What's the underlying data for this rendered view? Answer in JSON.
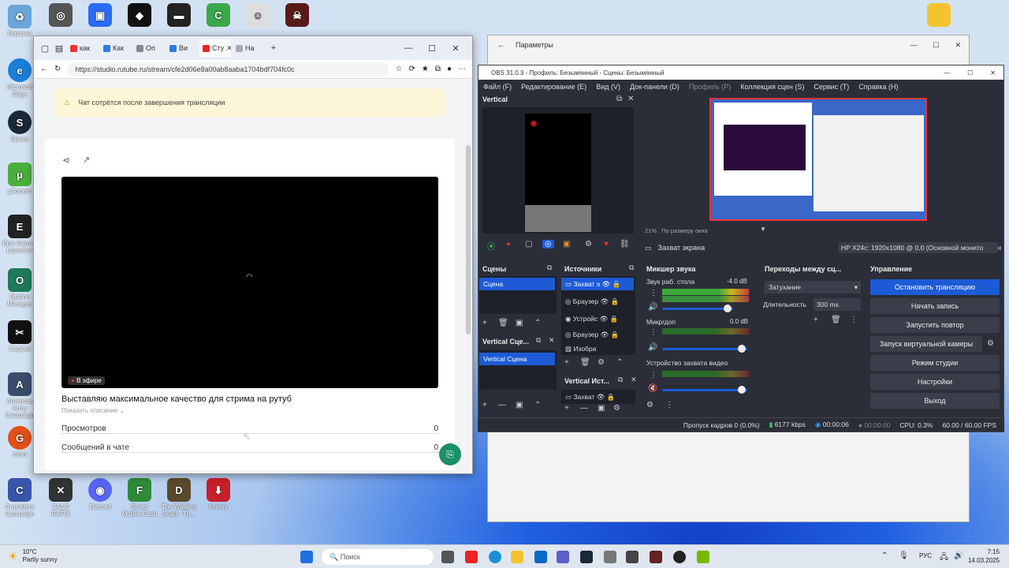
{
  "desktop": {
    "icons": [
      {
        "label": "Корзина",
        "color": "#6aa6d8"
      },
      {
        "label": "Microsoft Edge",
        "color": "#1a7fd8"
      },
      {
        "label": "Steam",
        "color": "#1b2838"
      },
      {
        "label": "µTorrent",
        "color": "#4caf3c"
      },
      {
        "label": "Epic Games Launcher",
        "color": "#222"
      },
      {
        "label": "Outline Manager",
        "color": "#1f7a5a"
      },
      {
        "label": "CapCut",
        "color": "#111"
      },
      {
        "label": "Americas Army Campaign",
        "color": "#3a4c6a"
      },
      {
        "label": "GOG",
        "color": "#e05018"
      },
      {
        "label": "Crusaders Campaign",
        "color": "#3855a8"
      }
    ],
    "top_icons": [
      "Outline",
      "Roblox Player",
      "Roblox Studio",
      "Garena",
      "CCleaner",
      "Rayman",
      "Rainbow"
    ],
    "bottom_icons": [
      "SALG RAFIX",
      "Discord",
      "Street Mobile Cash",
      "The Walking Dead - Th...",
      "Ummy"
    ]
  },
  "browser": {
    "tabs": [
      "как",
      "Как",
      "Оп",
      "Ви",
      "Сту",
      "На"
    ],
    "active_tab_index": 4,
    "url": "https://studio.rutube.ru/stream/cfe2d06e8a00ab8aaba1704bdf704fc0c",
    "notice": "Чат сотрётся после завершения трансляции",
    "live_badge": "В эфире",
    "stream_title": "Выставляю максимальное качество для стрима на рутуб",
    "show_description": "Показать описание",
    "stats": [
      {
        "label": "Просмотров",
        "value": "0"
      },
      {
        "label": "Сообщений в чате",
        "value": "0"
      }
    ]
  },
  "settings_window": {
    "title": "Параметры"
  },
  "obs": {
    "title": "OBS 31.0.3 - Профиль: Безымянный - Сцены: Безымянный",
    "menu": [
      "Файл (F)",
      "Редактирование (E)",
      "Вид (V)",
      "Док-панели (D)",
      "Профиль (P)",
      "Коллекция сцен (S)",
      "Сервис (T)",
      "Справка (H)"
    ],
    "vertical_label": "Vertical",
    "zoom": "21%",
    "fit_label": "По размеру окна",
    "source_label": "Захват экрана",
    "display_label": "Экран",
    "display_value": "HP X24c: 1920x1080 @ 0,0 (Основной монито",
    "scenes_header": "Сцены",
    "scenes": [
      "Сцена"
    ],
    "vertical_scenes_header": "Vertical Сце...",
    "vertical_scenes": [
      "Vertical Сцена"
    ],
    "sources_header": "Источники",
    "sources": [
      "Захват э",
      "Браузер",
      "Устройс",
      "Браузер",
      "Изобра"
    ],
    "vertical_sources_header": "Vertical Ист...",
    "vertical_sources": [
      "Захват"
    ],
    "mixer_header": "Микшер звука",
    "mixer": [
      {
        "name": "Звук раб. стола",
        "db": "-4.0 dB"
      },
      {
        "name": "Микр/доп",
        "db": "0.0 dB"
      },
      {
        "name": "Устройство захвата видео",
        "db": "0.0 dB"
      }
    ],
    "transitions_header": "Переходы между сц...",
    "transition": "Затухание",
    "duration_label": "Длительность",
    "duration": "300 ms",
    "controls_header": "Управление",
    "controls": [
      "Остановить трансляцию",
      "Начать запись",
      "Запустить повтор",
      "Запуск виртуальной камеры",
      "Режим студии",
      "Настройки",
      "Выход"
    ],
    "status": {
      "dropped": "Пропуск кадров 0 (0.0%)",
      "bitrate": "6177 kbps",
      "live_time": "00:00:06",
      "rec_time": "00:00:00",
      "cpu": "CPU: 0.3%",
      "fps": "60.00 / 60.00 FPS"
    }
  },
  "taskbar": {
    "weather_temp": "10°C",
    "weather_desc": "Partly sunny",
    "search_placeholder": "Поиск",
    "lang": "РУС",
    "time": "7:15",
    "date": "14.03.2025"
  }
}
